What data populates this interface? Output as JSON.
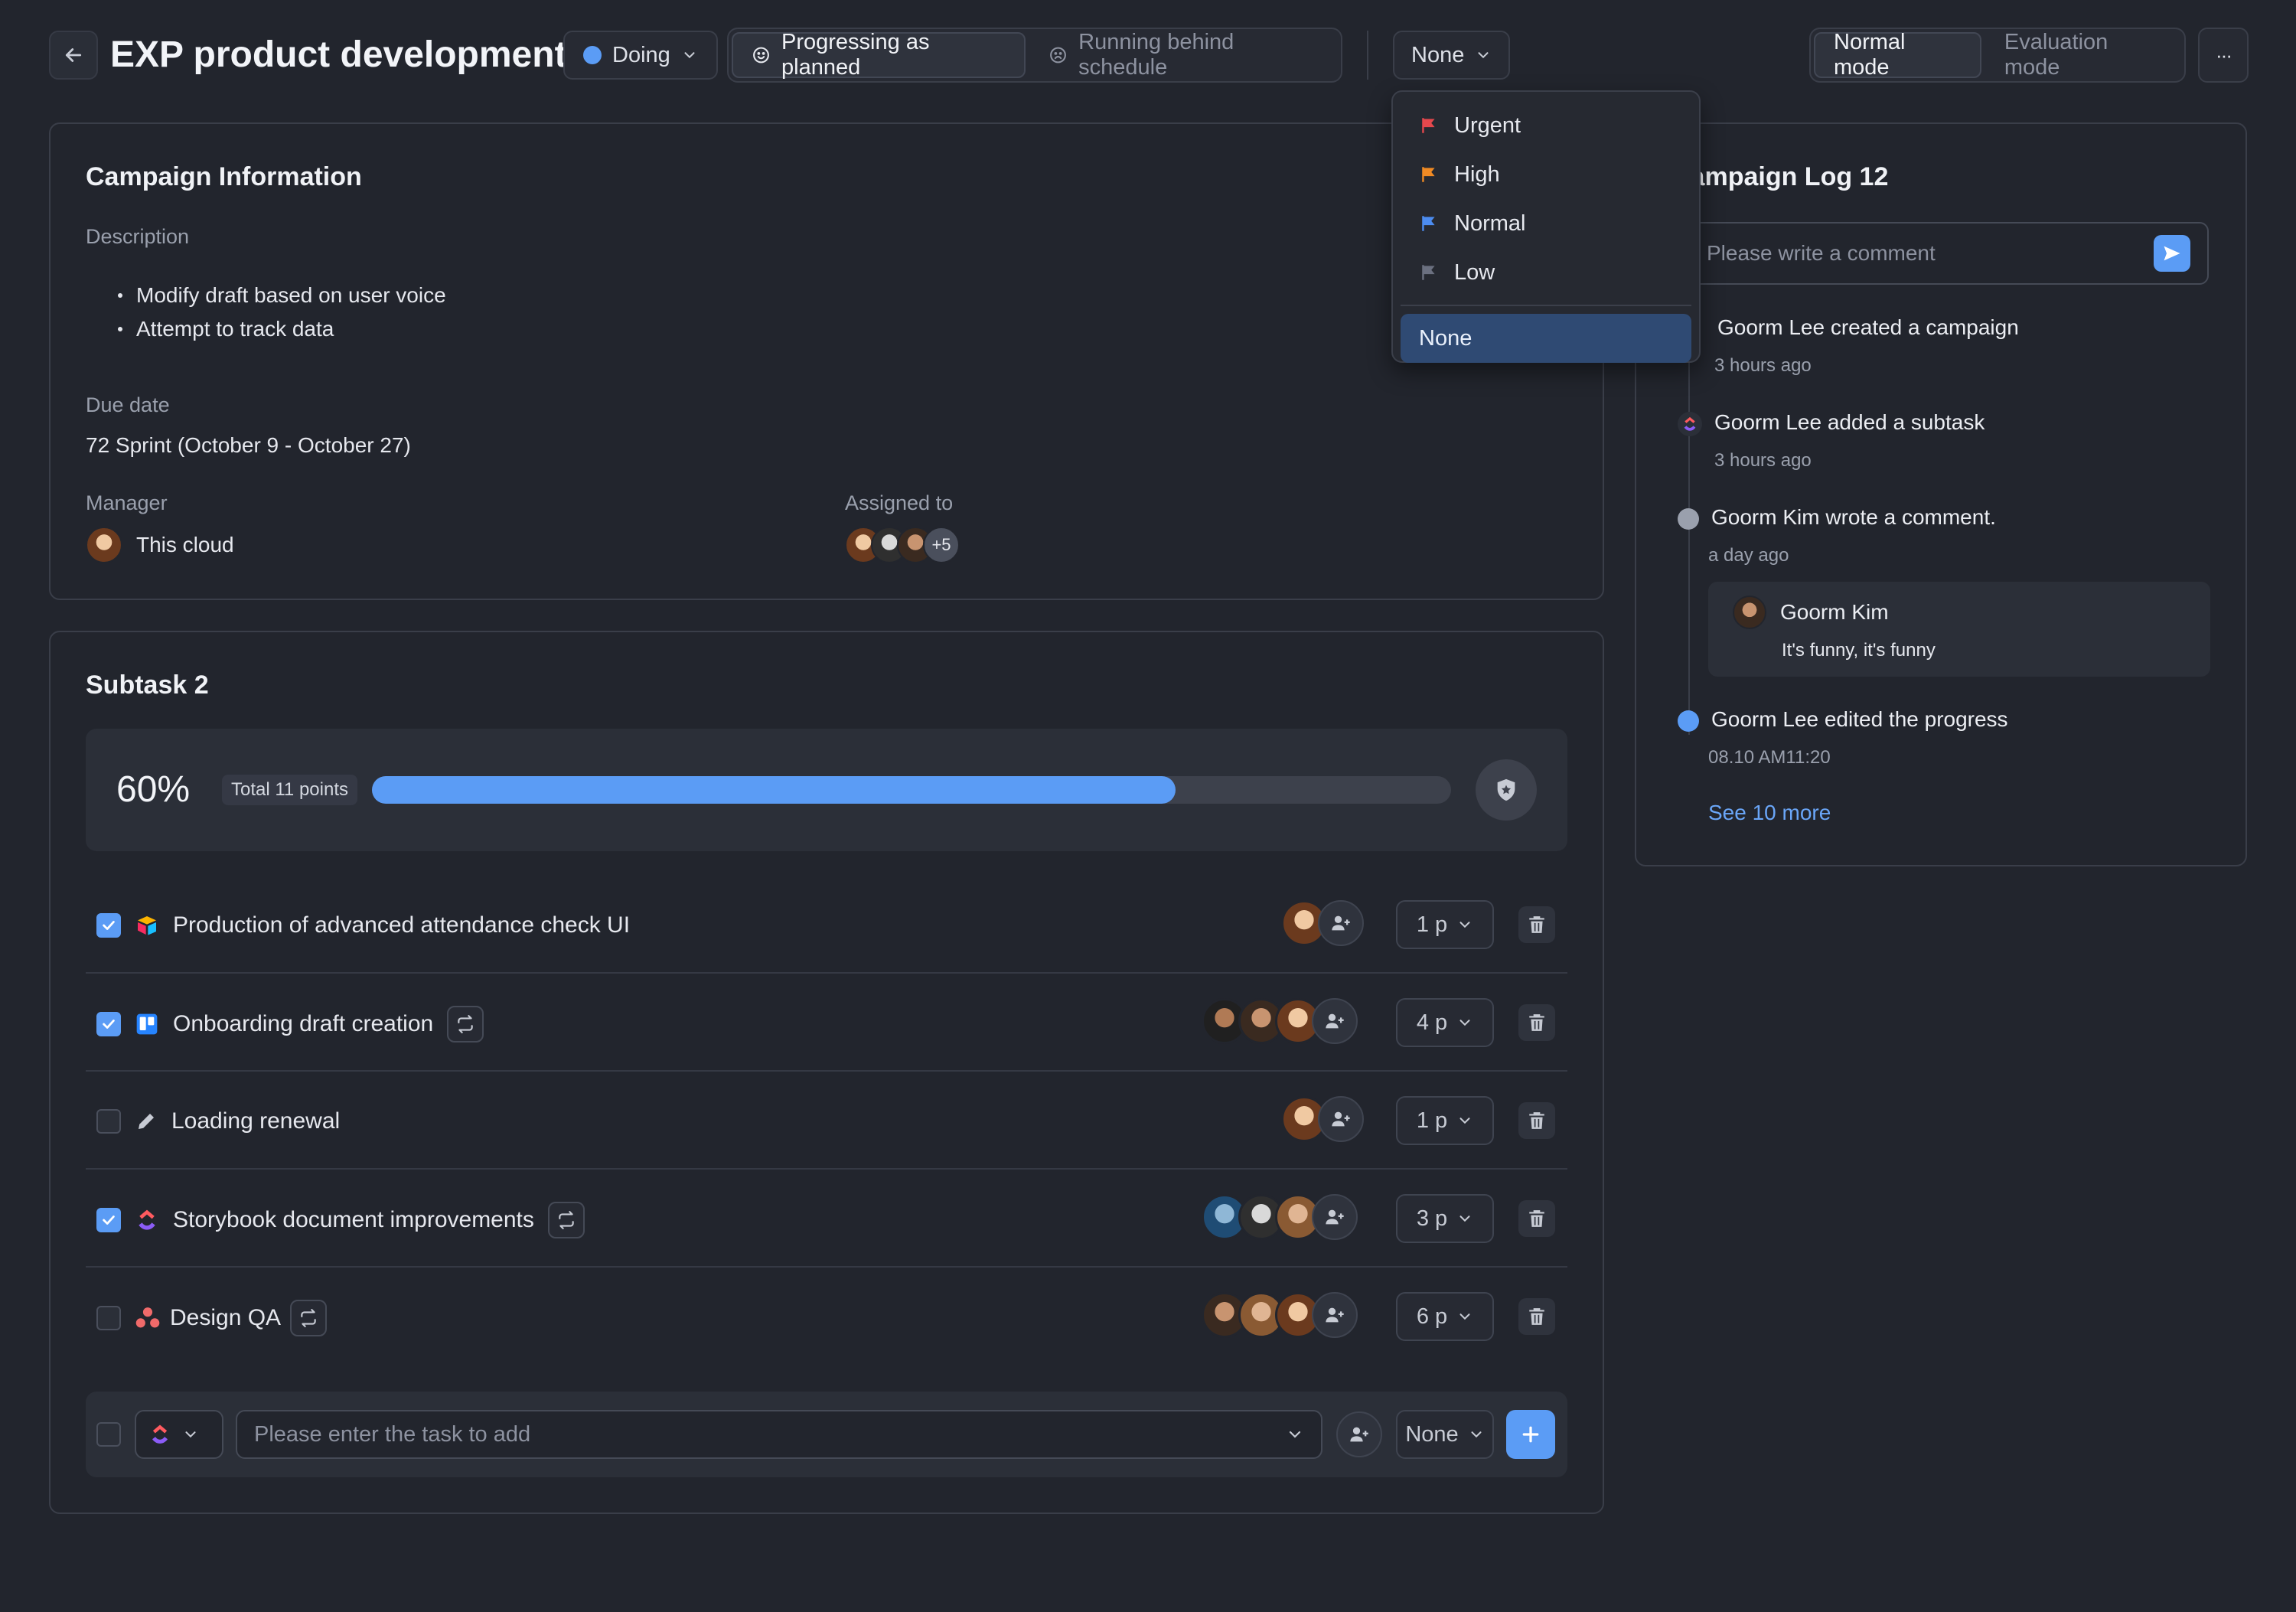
{
  "header": {
    "title": "EXP product development",
    "status": "Doing",
    "progress_options": [
      "Progressing as planned",
      "Running behind schedule"
    ],
    "priority_value": "None",
    "modes": [
      "Normal mode",
      "Evaluation mode"
    ],
    "more": "···"
  },
  "priority_menu": {
    "items": [
      {
        "label": "Urgent",
        "color": "#e5484d"
      },
      {
        "label": "High",
        "color": "#f08a24"
      },
      {
        "label": "Normal",
        "color": "#4c8cf0"
      },
      {
        "label": "Low",
        "color": "#6b7080"
      }
    ],
    "none_label": "None"
  },
  "campaign_info": {
    "title": "Campaign Information",
    "description_label": "Description",
    "description_items": [
      "Modify draft based on user voice",
      "Attempt to track data"
    ],
    "due_label": "Due date",
    "due_value": "72 Sprint (October 9 - October 27)",
    "manager_label": "Manager",
    "manager_name": "This cloud",
    "assigned_label": "Assigned to",
    "assigned_more": "+5"
  },
  "subtasks": {
    "title": "Subtask 2",
    "percent_text": "60%",
    "percent_value": 0.745,
    "total_points": "Total 11 points",
    "rows": [
      {
        "checked": true,
        "label": "Production of advanced attendance check UI",
        "points": "1 p",
        "repeat": false
      },
      {
        "checked": true,
        "label": "Onboarding draft creation",
        "points": "4 p",
        "repeat": true
      },
      {
        "checked": false,
        "label": "Loading renewal",
        "points": "1 p",
        "repeat": false
      },
      {
        "checked": true,
        "label": "Storybook document improvements",
        "points": "3 p",
        "repeat": true
      },
      {
        "checked": false,
        "label": "Design QA",
        "points": "6 p",
        "repeat": true
      }
    ],
    "add_placeholder": "Please enter the task to add",
    "add_points": "None"
  },
  "log": {
    "title": "Campaign Log 12",
    "comment_placeholder": "Please write a comment",
    "entries": [
      {
        "text": "Goorm Lee created a campaign",
        "time": "3 hours ago"
      },
      {
        "text": "Goorm Lee added a subtask",
        "time": "3 hours ago"
      },
      {
        "text": "Goorm Kim wrote a comment.",
        "time": "a day ago"
      },
      {
        "text": "Goorm Lee edited the progress",
        "time": "08.10 AM11:20"
      }
    ],
    "comment_author": "Goorm Kim",
    "comment_body": "It's funny, it's funny",
    "see_more": "See 10 more"
  },
  "colors": {
    "accent": "#5b9cf5",
    "background": "#22252d"
  }
}
